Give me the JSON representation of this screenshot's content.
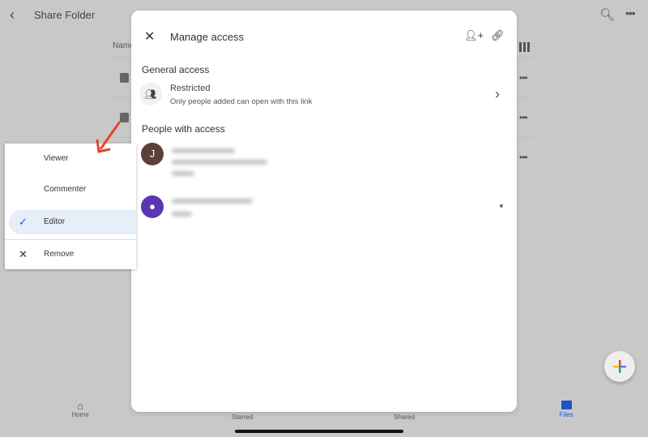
{
  "header": {
    "title": "Share Folder",
    "back_icon": "chevron-left-icon",
    "search_icon": "search-icon",
    "more_icon": "more-horizontal-icon"
  },
  "list": {
    "name_column": "Name",
    "rows": 3
  },
  "modal": {
    "title": "Manage access",
    "general_access_heading": "General access",
    "access_level": "Restricted",
    "access_description": "Only people added can open with this link",
    "people_heading": "People with access",
    "people": [
      {
        "initial": "J",
        "color": "#5d4037"
      },
      {
        "initial": "",
        "color": "#5e35b1"
      }
    ]
  },
  "role_menu": {
    "items": [
      {
        "label": "Viewer"
      },
      {
        "label": "Commenter"
      },
      {
        "label": "Editor",
        "selected": true
      },
      {
        "label": "Remove"
      }
    ],
    "accent": "#e6eef9"
  },
  "bottom_nav": {
    "items": [
      {
        "label": "Home"
      },
      {
        "label": "Starred"
      },
      {
        "label": "Shared"
      },
      {
        "label": "Files",
        "active": true
      }
    ],
    "active_color": "#1a56c9"
  },
  "annotation_arrow_color": "#e8442a"
}
